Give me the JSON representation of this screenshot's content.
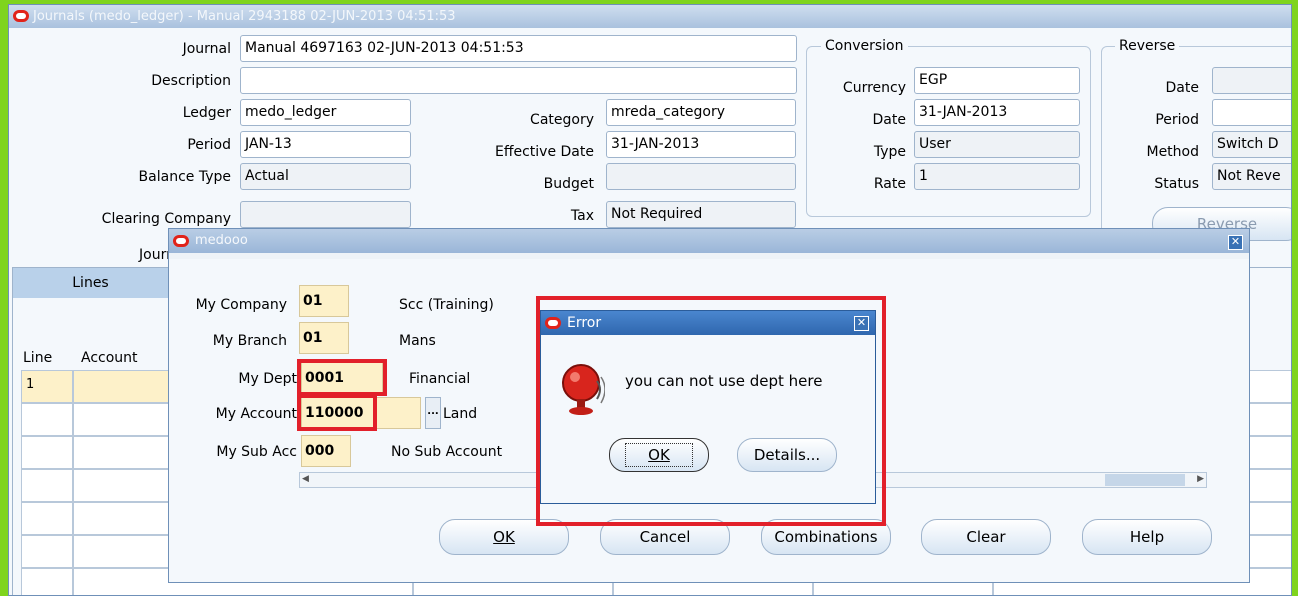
{
  "window": {
    "title": "Journals (medo_ledger) - Manual 2943188 02-JUN-2013 04:51:53"
  },
  "header": {
    "journal_label": "Journal",
    "journal_value": "Manual 4697163 02-JUN-2013 04:51:53",
    "description_label": "Description",
    "description_value": "",
    "ledger_label": "Ledger",
    "ledger_value": "medo_ledger",
    "period_label": "Period",
    "period_value": "JAN-13",
    "balance_type_label": "Balance Type",
    "balance_type_value": "Actual",
    "clearing_company_label": "Clearing Company",
    "clearing_company_value": "",
    "journal_partial_label": "Journ",
    "category_label": "Category",
    "category_value": "mreda_category",
    "effective_date_label": "Effective Date",
    "effective_date_value": "31-JAN-2013",
    "budget_label": "Budget",
    "budget_value": "",
    "tax_label": "Tax",
    "tax_value": "Not Required"
  },
  "conversion": {
    "title": "Conversion",
    "currency_label": "Currency",
    "currency_value": "EGP",
    "date_label": "Date",
    "date_value": "31-JAN-2013",
    "type_label": "Type",
    "type_value": "User",
    "rate_label": "Rate",
    "rate_value": "1"
  },
  "reverse": {
    "title": "Reverse",
    "date_label": "Date",
    "date_value": "",
    "period_label": "Period",
    "period_value": "",
    "method_label": "Method",
    "method_value": "Switch D",
    "status_label": "Status",
    "status_value": "Not Reve",
    "reverse_button": "Reverse"
  },
  "lines": {
    "tab_label": "Lines",
    "col_line": "Line",
    "col_account": "Account",
    "first_row_line": "1"
  },
  "flex_dialog": {
    "title": "medooo",
    "rows": [
      {
        "label": "My Company",
        "value": "01",
        "desc": "Scc (Training)"
      },
      {
        "label": "My Branch",
        "value": "01",
        "desc": "Mans"
      },
      {
        "label": "My Dept",
        "value": "0001",
        "desc": "Financial"
      },
      {
        "label": "My Account",
        "value": "110000",
        "desc": "Land"
      },
      {
        "label": "My Sub Acc",
        "value": "000",
        "desc": "No Sub Account"
      }
    ],
    "lov_button": "...",
    "buttons": {
      "ok": "OK",
      "cancel": "Cancel",
      "combinations": "Combinations",
      "clear": "Clear",
      "help": "Help"
    }
  },
  "error_dialog": {
    "title": "Error",
    "message": "you can not use dept here",
    "ok_button": "OK",
    "details_button": "Details..."
  },
  "colors": {
    "accent_red": "#e2202a",
    "background_green": "#7fd41e",
    "field_yellow": "#fdf1c9"
  }
}
